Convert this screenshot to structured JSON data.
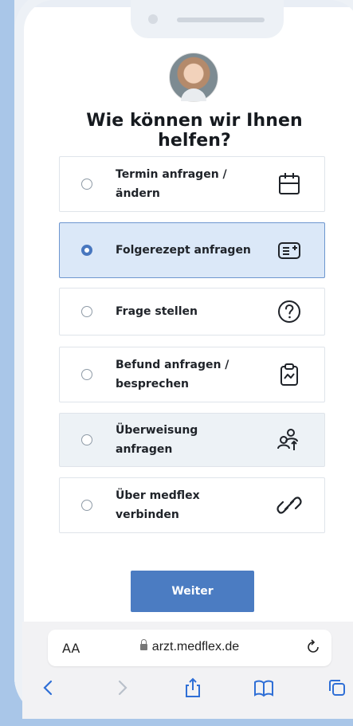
{
  "heading": "Wie können wir Ihnen helfen?",
  "options": [
    {
      "label": "Termin anfragen / ändern",
      "icon": "calendar-icon",
      "selected": false
    },
    {
      "label": "Folgerezept anfragen",
      "icon": "prescription-add-icon",
      "selected": true
    },
    {
      "label": "Frage stellen",
      "icon": "question-icon",
      "selected": false
    },
    {
      "label": "Befund anfragen / besprechen",
      "icon": "clipboard-chart-icon",
      "selected": false
    },
    {
      "label": "Überweisung anfragen",
      "icon": "referral-icon",
      "selected": false
    },
    {
      "label": "Über medflex verbinden",
      "icon": "link-icon",
      "selected": false
    }
  ],
  "continue_button": "Weiter",
  "browser": {
    "text_size": "AA",
    "url": "arzt.medflex.de"
  },
  "colors": {
    "accent": "#4b7cc2",
    "selected_bg": "#dbe8f8",
    "page_bg": "#a9c6e8"
  }
}
